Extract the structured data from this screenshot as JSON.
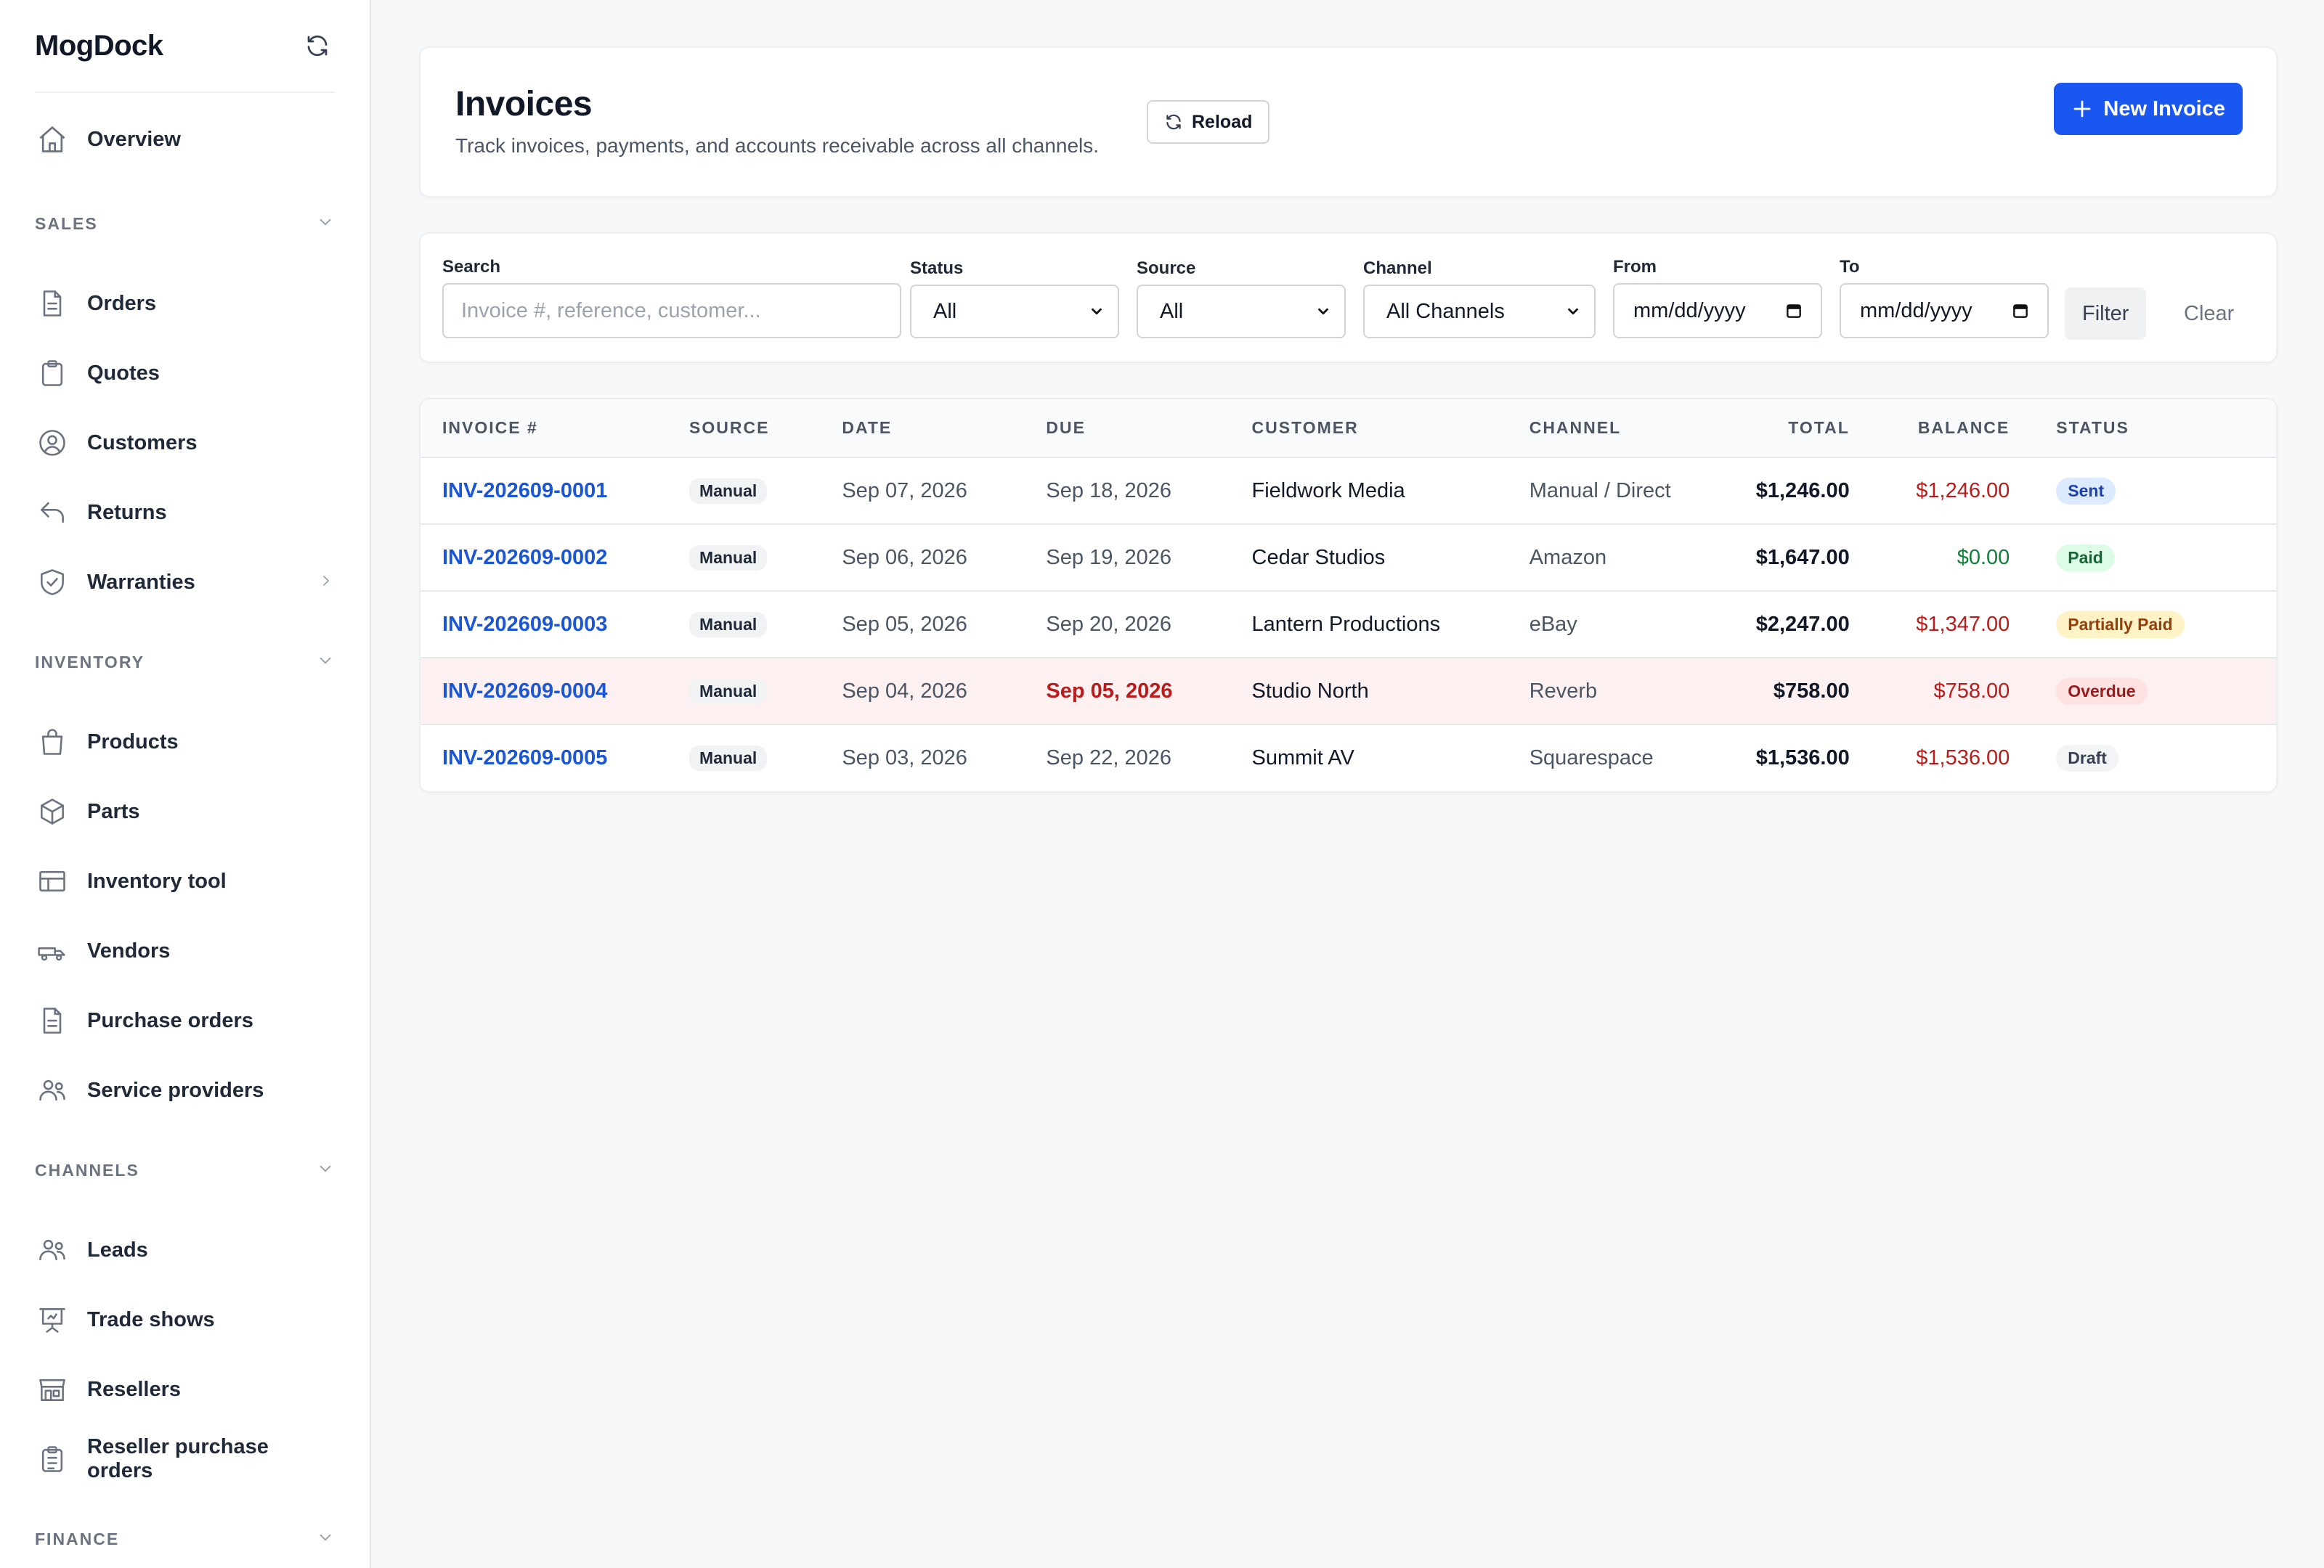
{
  "app": {
    "name": "MogDock"
  },
  "sidebar": {
    "overview": "Overview",
    "sections": [
      {
        "label": "SALES",
        "items": [
          {
            "label": "Orders",
            "icon": "document-icon"
          },
          {
            "label": "Quotes",
            "icon": "clipboard-icon"
          },
          {
            "label": "Customers",
            "icon": "user-circle-icon"
          },
          {
            "label": "Returns",
            "icon": "return-arrow-icon"
          },
          {
            "label": "Warranties",
            "icon": "shield-icon",
            "has_submenu": true
          }
        ]
      },
      {
        "label": "INVENTORY",
        "items": [
          {
            "label": "Products",
            "icon": "shopping-bag-icon"
          },
          {
            "label": "Parts",
            "icon": "cube-icon"
          },
          {
            "label": "Inventory tool",
            "icon": "table-icon"
          },
          {
            "label": "Vendors",
            "icon": "truck-icon"
          },
          {
            "label": "Purchase orders",
            "icon": "document-icon"
          },
          {
            "label": "Service providers",
            "icon": "users-icon"
          }
        ]
      },
      {
        "label": "CHANNELS",
        "items": [
          {
            "label": "Leads",
            "icon": "users-icon"
          },
          {
            "label": "Trade shows",
            "icon": "presentation-icon"
          },
          {
            "label": "Resellers",
            "icon": "storefront-icon"
          },
          {
            "label": "Reseller purchase orders",
            "icon": "clipboard-list-icon"
          }
        ]
      },
      {
        "label": "FINANCE",
        "items": []
      }
    ]
  },
  "header": {
    "title": "Invoices",
    "subtitle": "Track invoices, payments, and accounts receivable across all channels.",
    "reload_label": "Reload",
    "new_label": "New Invoice"
  },
  "filters": {
    "search_label": "Search",
    "search_placeholder": "Invoice #, reference, customer...",
    "status_label": "Status",
    "status_value": "All",
    "source_label": "Source",
    "source_value": "All",
    "channel_label": "Channel",
    "channel_value": "All Channels",
    "from_label": "From",
    "from_value": "mm/dd/yyyy",
    "to_label": "To",
    "to_value": "mm/dd/yyyy",
    "filter_label": "Filter",
    "clear_label": "Clear"
  },
  "table": {
    "columns": [
      "INVOICE #",
      "SOURCE",
      "DATE",
      "DUE",
      "CUSTOMER",
      "CHANNEL",
      "TOTAL",
      "BALANCE",
      "STATUS"
    ],
    "rows": [
      {
        "invoice": "INV-202609-0001",
        "source": "Manual",
        "date": "Sep 07, 2026",
        "due": "Sep 18, 2026",
        "customer": "Fieldwork Media",
        "channel": "Manual / Direct",
        "total": "$1,246.00",
        "balance": "$1,246.00",
        "status": "Sent",
        "overdue": false
      },
      {
        "invoice": "INV-202609-0002",
        "source": "Manual",
        "date": "Sep 06, 2026",
        "due": "Sep 19, 2026",
        "customer": "Cedar Studios",
        "channel": "Amazon",
        "total": "$1,647.00",
        "balance": "$0.00",
        "status": "Paid",
        "overdue": false
      },
      {
        "invoice": "INV-202609-0003",
        "source": "Manual",
        "date": "Sep 05, 2026",
        "due": "Sep 20, 2026",
        "customer": "Lantern Productions",
        "channel": "eBay",
        "total": "$2,247.00",
        "balance": "$1,347.00",
        "status": "Partially Paid",
        "overdue": false
      },
      {
        "invoice": "INV-202609-0004",
        "source": "Manual",
        "date": "Sep 04, 2026",
        "due": "Sep 05, 2026",
        "customer": "Studio North",
        "channel": "Reverb",
        "total": "$758.00",
        "balance": "$758.00",
        "status": "Overdue",
        "overdue": true
      },
      {
        "invoice": "INV-202609-0005",
        "source": "Manual",
        "date": "Sep 03, 2026",
        "due": "Sep 22, 2026",
        "customer": "Summit AV",
        "channel": "Squarespace",
        "total": "$1,536.00",
        "balance": "$1,536.00",
        "status": "Draft",
        "overdue": false
      }
    ]
  },
  "colors": {
    "primary": "#1a56f0",
    "link": "#1a56d6",
    "balance_due": "#b91c1c",
    "balance_paid": "#15803d",
    "overdue_row": "#fdf0f0",
    "status": {
      "Sent": {
        "bg": "#dbeafe",
        "fg": "#1e40af"
      },
      "Paid": {
        "bg": "#dcfce7",
        "fg": "#166534"
      },
      "Partially Paid": {
        "bg": "#fef3c7",
        "fg": "#92400e"
      },
      "Overdue": {
        "bg": "#fee2e2",
        "fg": "#991b1b"
      },
      "Draft": {
        "bg": "#f3f4f6",
        "fg": "#374151"
      }
    }
  }
}
